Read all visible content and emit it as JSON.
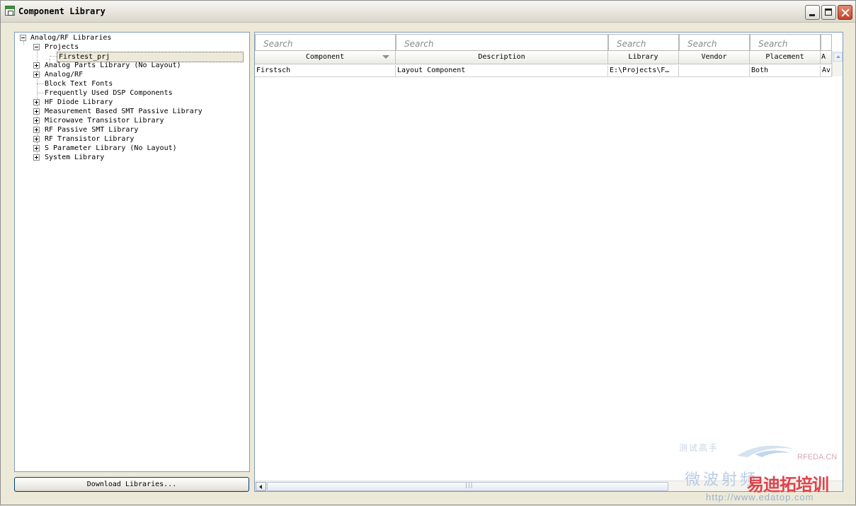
{
  "window": {
    "title": "Component Library"
  },
  "tree": {
    "nodes": [
      {
        "label": "Analog/RF Libraries",
        "expander": "minus"
      },
      {
        "label": "Projects",
        "expander": "minus"
      },
      {
        "label": "Firstest_prj",
        "expander": "none",
        "selected": true
      },
      {
        "label": "Analog Parts Library (No Layout)",
        "expander": "plus"
      },
      {
        "label": "Analog/RF",
        "expander": "plus"
      },
      {
        "label": "Block Text Fonts",
        "expander": "none"
      },
      {
        "label": "Frequently Used DSP Components",
        "expander": "none"
      },
      {
        "label": "HF Diode Library",
        "expander": "plus"
      },
      {
        "label": "Measurement Based SMT Passive Library",
        "expander": "plus"
      },
      {
        "label": "Microwave Transistor Library",
        "expander": "plus"
      },
      {
        "label": "RF Passive SMT Library",
        "expander": "plus"
      },
      {
        "label": "RF Transistor Library",
        "expander": "plus"
      },
      {
        "label": "S Parameter Library (No Layout)",
        "expander": "plus"
      },
      {
        "label": "System Library",
        "expander": "plus"
      }
    ]
  },
  "buttons": {
    "download": "Download Libraries..."
  },
  "table": {
    "search_placeholder": "Search",
    "columns": [
      "Component",
      "Description",
      "Library",
      "Vendor",
      "Placement",
      "A"
    ],
    "sorted_column": "Component",
    "rows": [
      [
        "Firstsch",
        "Layout Component",
        "E:\\Projects\\F…",
        "",
        "Both",
        "Av"
      ]
    ]
  },
  "watermark": {
    "line1": "测试高手",
    "brand": "RFEDA.CN",
    "cn": "微波射频",
    "training": "易迪拓培训",
    "url": "http://www.edatop.com"
  }
}
